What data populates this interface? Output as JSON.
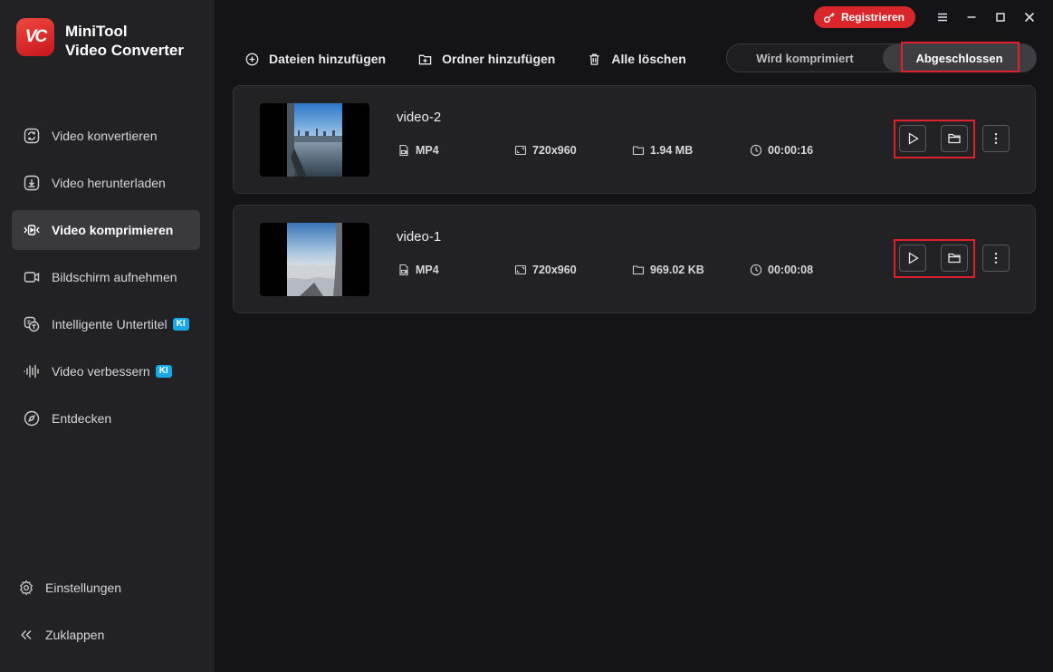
{
  "app": {
    "logo_text": "VC",
    "title_line1": "MiniTool",
    "title_line2": "Video Converter"
  },
  "sidebar": {
    "items": [
      {
        "label": "Video konvertieren",
        "icon": "convert-icon"
      },
      {
        "label": "Video herunterladen",
        "icon": "download-icon"
      },
      {
        "label": "Video komprimieren",
        "icon": "compress-icon",
        "active": true
      },
      {
        "label": "Bildschirm aufnehmen",
        "icon": "camera-icon"
      },
      {
        "label": "Intelligente Untertitel",
        "icon": "subtitle-icon",
        "badge": "KI"
      },
      {
        "label": "Video verbessern",
        "icon": "waveform-icon",
        "badge": "KI"
      },
      {
        "label": "Entdecken",
        "icon": "compass-icon"
      }
    ],
    "settings_label": "Einstellungen",
    "collapse_label": "Zuklappen"
  },
  "topbar": {
    "register_label": "Registrieren"
  },
  "toolbar": {
    "add_files": "Dateien hinzufügen",
    "add_folder": "Ordner hinzufügen",
    "delete_all": "Alle löschen"
  },
  "tabs": {
    "compressing": "Wird komprimiert",
    "completed": "Abgeschlossen",
    "active": "completed"
  },
  "videos": [
    {
      "name": "video-2",
      "format": "MP4",
      "resolution": "720x960",
      "size": "1.94 MB",
      "duration": "00:00:16"
    },
    {
      "name": "video-1",
      "format": "MP4",
      "resolution": "720x960",
      "size": "969.02 KB",
      "duration": "00:00:08"
    }
  ],
  "colors": {
    "accent_red": "#d9262b",
    "highlight_box": "#e0212a",
    "ki_badge": "#19a7e6"
  }
}
